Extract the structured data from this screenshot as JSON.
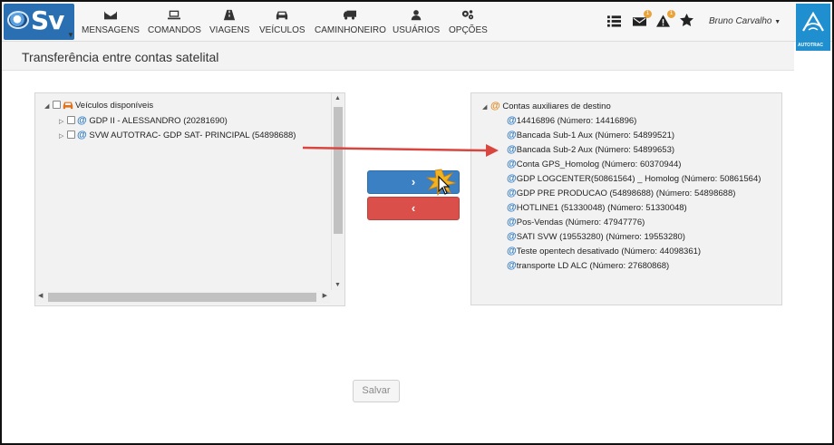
{
  "app": {
    "logo_text": "Sv",
    "page_title": "Transferência entre contas satelital",
    "user_name": "Bruno Carvalho",
    "brand_text": "AUTOTRAC"
  },
  "nav": {
    "items": [
      {
        "label": "MENSAGENS",
        "icon": "envelope-icon"
      },
      {
        "label": "COMANDOS",
        "icon": "laptop-icon"
      },
      {
        "label": "VIAGENS",
        "icon": "road-icon"
      },
      {
        "label": "VEÍCULOS",
        "icon": "car-icon"
      },
      {
        "label": "CAMINHONEIRO",
        "icon": "truck-icon"
      },
      {
        "label": "USUÁRIOS",
        "icon": "user-icon"
      },
      {
        "label": "OPÇÕES",
        "icon": "gears-icon"
      }
    ]
  },
  "toolbar": {
    "badge_messages": "1",
    "badge_alerts": "1"
  },
  "left_tree": {
    "root_label": "Veículos disponíveis",
    "items": [
      "GDP II - ALESSANDRO (20281690)",
      "SVW AUTOTRAC- GDP SAT- PRINCIPAL (54898688)"
    ]
  },
  "right_tree": {
    "root_label": "Contas auxiliares de destino",
    "items": [
      "14416896 (Número: 14416896)",
      "Bancada Sub-1 Aux (Número: 54899521)",
      "Bancada Sub-2 Aux (Número: 54899653)",
      "Conta GPS_Homolog (Número: 60370944)",
      "GDP LOGCENTER(50861564) _ Homolog (Número: 50861564)",
      "GDP PRE PRODUCAO (54898688) (Número: 54898688)",
      "HOTLINE1 (51330048) (Número: 51330048)",
      "Pos-Vendas (Número: 47947776)",
      "SATI SVW (19553280) (Número: 19553280)",
      "Teste opentech desativado (Número: 44098361)",
      "transporte LD ALC (Número: 27680868)"
    ]
  },
  "buttons": {
    "move_right": "›",
    "move_left": "‹",
    "save": "Salvar"
  },
  "colors": {
    "primary": "#3a80c3",
    "danger": "#da4f49",
    "annotation_arrow": "#d9453f",
    "brand": "#1f8fd0"
  }
}
